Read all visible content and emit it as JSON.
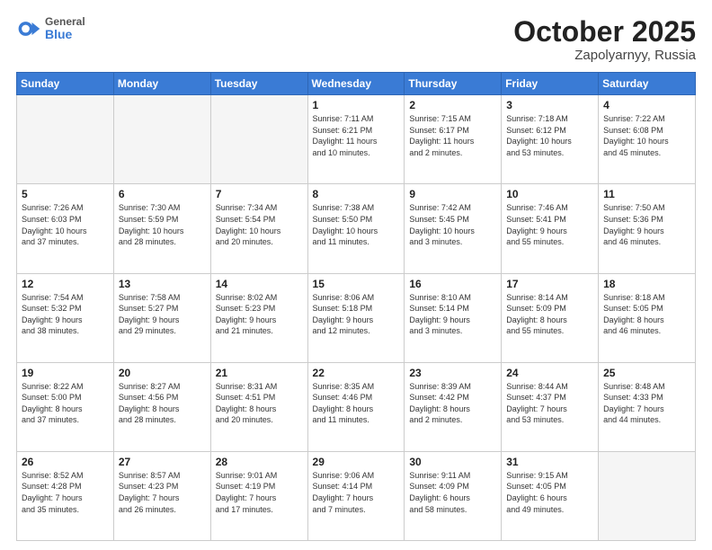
{
  "header": {
    "logo_general": "General",
    "logo_blue": "Blue",
    "month_title": "October 2025",
    "location": "Zapolyarnyy, Russia"
  },
  "days_of_week": [
    "Sunday",
    "Monday",
    "Tuesday",
    "Wednesday",
    "Thursday",
    "Friday",
    "Saturday"
  ],
  "weeks": [
    [
      {
        "day": "",
        "content": "",
        "empty": true
      },
      {
        "day": "",
        "content": "",
        "empty": true
      },
      {
        "day": "",
        "content": "",
        "empty": true
      },
      {
        "day": "1",
        "content": "Sunrise: 7:11 AM\nSunset: 6:21 PM\nDaylight: 11 hours\nand 10 minutes.",
        "empty": false
      },
      {
        "day": "2",
        "content": "Sunrise: 7:15 AM\nSunset: 6:17 PM\nDaylight: 11 hours\nand 2 minutes.",
        "empty": false
      },
      {
        "day": "3",
        "content": "Sunrise: 7:18 AM\nSunset: 6:12 PM\nDaylight: 10 hours\nand 53 minutes.",
        "empty": false
      },
      {
        "day": "4",
        "content": "Sunrise: 7:22 AM\nSunset: 6:08 PM\nDaylight: 10 hours\nand 45 minutes.",
        "empty": false
      }
    ],
    [
      {
        "day": "5",
        "content": "Sunrise: 7:26 AM\nSunset: 6:03 PM\nDaylight: 10 hours\nand 37 minutes.",
        "empty": false
      },
      {
        "day": "6",
        "content": "Sunrise: 7:30 AM\nSunset: 5:59 PM\nDaylight: 10 hours\nand 28 minutes.",
        "empty": false
      },
      {
        "day": "7",
        "content": "Sunrise: 7:34 AM\nSunset: 5:54 PM\nDaylight: 10 hours\nand 20 minutes.",
        "empty": false
      },
      {
        "day": "8",
        "content": "Sunrise: 7:38 AM\nSunset: 5:50 PM\nDaylight: 10 hours\nand 11 minutes.",
        "empty": false
      },
      {
        "day": "9",
        "content": "Sunrise: 7:42 AM\nSunset: 5:45 PM\nDaylight: 10 hours\nand 3 minutes.",
        "empty": false
      },
      {
        "day": "10",
        "content": "Sunrise: 7:46 AM\nSunset: 5:41 PM\nDaylight: 9 hours\nand 55 minutes.",
        "empty": false
      },
      {
        "day": "11",
        "content": "Sunrise: 7:50 AM\nSunset: 5:36 PM\nDaylight: 9 hours\nand 46 minutes.",
        "empty": false
      }
    ],
    [
      {
        "day": "12",
        "content": "Sunrise: 7:54 AM\nSunset: 5:32 PM\nDaylight: 9 hours\nand 38 minutes.",
        "empty": false
      },
      {
        "day": "13",
        "content": "Sunrise: 7:58 AM\nSunset: 5:27 PM\nDaylight: 9 hours\nand 29 minutes.",
        "empty": false
      },
      {
        "day": "14",
        "content": "Sunrise: 8:02 AM\nSunset: 5:23 PM\nDaylight: 9 hours\nand 21 minutes.",
        "empty": false
      },
      {
        "day": "15",
        "content": "Sunrise: 8:06 AM\nSunset: 5:18 PM\nDaylight: 9 hours\nand 12 minutes.",
        "empty": false
      },
      {
        "day": "16",
        "content": "Sunrise: 8:10 AM\nSunset: 5:14 PM\nDaylight: 9 hours\nand 3 minutes.",
        "empty": false
      },
      {
        "day": "17",
        "content": "Sunrise: 8:14 AM\nSunset: 5:09 PM\nDaylight: 8 hours\nand 55 minutes.",
        "empty": false
      },
      {
        "day": "18",
        "content": "Sunrise: 8:18 AM\nSunset: 5:05 PM\nDaylight: 8 hours\nand 46 minutes.",
        "empty": false
      }
    ],
    [
      {
        "day": "19",
        "content": "Sunrise: 8:22 AM\nSunset: 5:00 PM\nDaylight: 8 hours\nand 37 minutes.",
        "empty": false
      },
      {
        "day": "20",
        "content": "Sunrise: 8:27 AM\nSunset: 4:56 PM\nDaylight: 8 hours\nand 28 minutes.",
        "empty": false
      },
      {
        "day": "21",
        "content": "Sunrise: 8:31 AM\nSunset: 4:51 PM\nDaylight: 8 hours\nand 20 minutes.",
        "empty": false
      },
      {
        "day": "22",
        "content": "Sunrise: 8:35 AM\nSunset: 4:46 PM\nDaylight: 8 hours\nand 11 minutes.",
        "empty": false
      },
      {
        "day": "23",
        "content": "Sunrise: 8:39 AM\nSunset: 4:42 PM\nDaylight: 8 hours\nand 2 minutes.",
        "empty": false
      },
      {
        "day": "24",
        "content": "Sunrise: 8:44 AM\nSunset: 4:37 PM\nDaylight: 7 hours\nand 53 minutes.",
        "empty": false
      },
      {
        "day": "25",
        "content": "Sunrise: 8:48 AM\nSunset: 4:33 PM\nDaylight: 7 hours\nand 44 minutes.",
        "empty": false
      }
    ],
    [
      {
        "day": "26",
        "content": "Sunrise: 8:52 AM\nSunset: 4:28 PM\nDaylight: 7 hours\nand 35 minutes.",
        "empty": false
      },
      {
        "day": "27",
        "content": "Sunrise: 8:57 AM\nSunset: 4:23 PM\nDaylight: 7 hours\nand 26 minutes.",
        "empty": false
      },
      {
        "day": "28",
        "content": "Sunrise: 9:01 AM\nSunset: 4:19 PM\nDaylight: 7 hours\nand 17 minutes.",
        "empty": false
      },
      {
        "day": "29",
        "content": "Sunrise: 9:06 AM\nSunset: 4:14 PM\nDaylight: 7 hours\nand 7 minutes.",
        "empty": false
      },
      {
        "day": "30",
        "content": "Sunrise: 9:11 AM\nSunset: 4:09 PM\nDaylight: 6 hours\nand 58 minutes.",
        "empty": false
      },
      {
        "day": "31",
        "content": "Sunrise: 9:15 AM\nSunset: 4:05 PM\nDaylight: 6 hours\nand 49 minutes.",
        "empty": false
      },
      {
        "day": "",
        "content": "",
        "empty": true
      }
    ]
  ]
}
